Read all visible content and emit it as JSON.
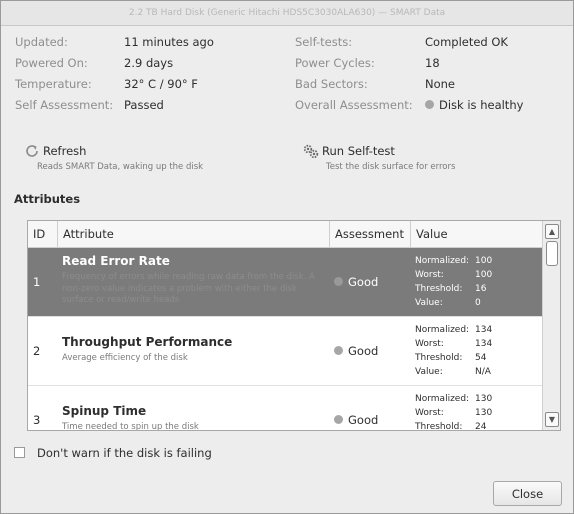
{
  "window": {
    "title": "2.2 TB Hard Disk (Generic Hitachi HDS5C3030ALA630) — SMART Data"
  },
  "info": {
    "updated": {
      "label": "Updated:",
      "value": "11 minutes ago"
    },
    "powered_on": {
      "label": "Powered On:",
      "value": "2.9 days"
    },
    "temperature": {
      "label": "Temperature:",
      "value": "32° C / 90° F"
    },
    "self_assessment": {
      "label": "Self Assessment:",
      "value": "Passed"
    },
    "self_tests": {
      "label": "Self-tests:",
      "value": "Completed OK"
    },
    "power_cycles": {
      "label": "Power Cycles:",
      "value": "18"
    },
    "bad_sectors": {
      "label": "Bad Sectors:",
      "value": "None"
    },
    "overall_assessment": {
      "label": "Overall Assessment:",
      "value": "Disk is healthy"
    }
  },
  "actions": {
    "refresh": {
      "title": "Refresh",
      "subtitle": "Reads SMART Data, waking up the disk",
      "icon": "refresh-icon"
    },
    "selftest": {
      "title": "Run Self-test",
      "subtitle": "Test the disk surface for errors",
      "icon": "gears-icon"
    }
  },
  "attributes": {
    "section_title": "Attributes",
    "columns": {
      "id": "ID",
      "attribute": "Attribute",
      "assessment": "Assessment",
      "value": "Value"
    },
    "value_keys": {
      "normalized": "Normalized:",
      "worst": "Worst:",
      "threshold": "Threshold:",
      "value": "Value:"
    },
    "rows": [
      {
        "id": "1",
        "name": "Read Error Rate",
        "description": "Frequency of errors while reading raw data from the disk. A non-zero value indicates a problem with either the disk surface or read/write heads",
        "assessment": "Good",
        "normalized": "100",
        "worst": "100",
        "threshold": "16",
        "value": "0",
        "selected": true
      },
      {
        "id": "2",
        "name": "Throughput Performance",
        "description": "Average efficiency of the disk",
        "assessment": "Good",
        "normalized": "134",
        "worst": "134",
        "threshold": "54",
        "value": "N/A",
        "selected": false
      },
      {
        "id": "3",
        "name": "Spinup Time",
        "description": "Time needed to spin up the disk",
        "assessment": "Good",
        "normalized": "130",
        "worst": "130",
        "threshold": "24",
        "value": "",
        "selected": false
      }
    ]
  },
  "footer": {
    "dont_warn_label": "Don't warn if the disk is failing",
    "dont_warn_checked": false,
    "close_label": "Close"
  },
  "colors": {
    "selected_row": "#7b7b7b",
    "status_dot": "#a6a6a6",
    "window_bg": "#ededed"
  }
}
